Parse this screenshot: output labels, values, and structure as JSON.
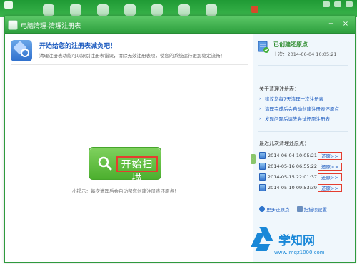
{
  "window": {
    "title": "电脑清理-清理注册表",
    "controls": {
      "min": "−",
      "close": "×"
    }
  },
  "header": {
    "title": "开始给您的注册表减负吧！",
    "desc": "清理注册表功能可以识别注册表错误，清除无效注册表项，使您的系统运行更加稳定流畅！"
  },
  "scan": {
    "button_label": "开始扫描",
    "tip": "小提示：每次清理后会自动帮您创建注册表还原点！"
  },
  "sidebar": {
    "restore_point": {
      "title": "已创建还原点",
      "time": "上次：2014-06-04 10:05:21"
    },
    "about": {
      "title": "关于清理注册表：",
      "tips": [
        "建议您每7天清理一次注册表",
        "清理完成后会自动创建注册表还原点",
        "发现问题后请先尝试还原注册表"
      ]
    },
    "recent": {
      "title": "最近几次清理还原点：",
      "items": [
        {
          "date": "2014-06-04 10:05:21",
          "action": "还原>>"
        },
        {
          "date": "2014-05-16 06:55:22",
          "action": "还原>>"
        },
        {
          "date": "2014-05-15 22:01:37",
          "action": "还原>>"
        },
        {
          "date": "2014-05-10 09:53:39",
          "action": "还原>>"
        }
      ]
    },
    "more_link": "更多还原点",
    "settings_link": "扫描项设置"
  },
  "watermark": {
    "main": "学知网",
    "url": "www.jmqz1000.com"
  },
  "colors": {
    "accent_green": "#4caf2e",
    "link_blue": "#1b5abf",
    "highlight_red": "#e53d2f",
    "watermark_blue": "#1a88d8"
  }
}
